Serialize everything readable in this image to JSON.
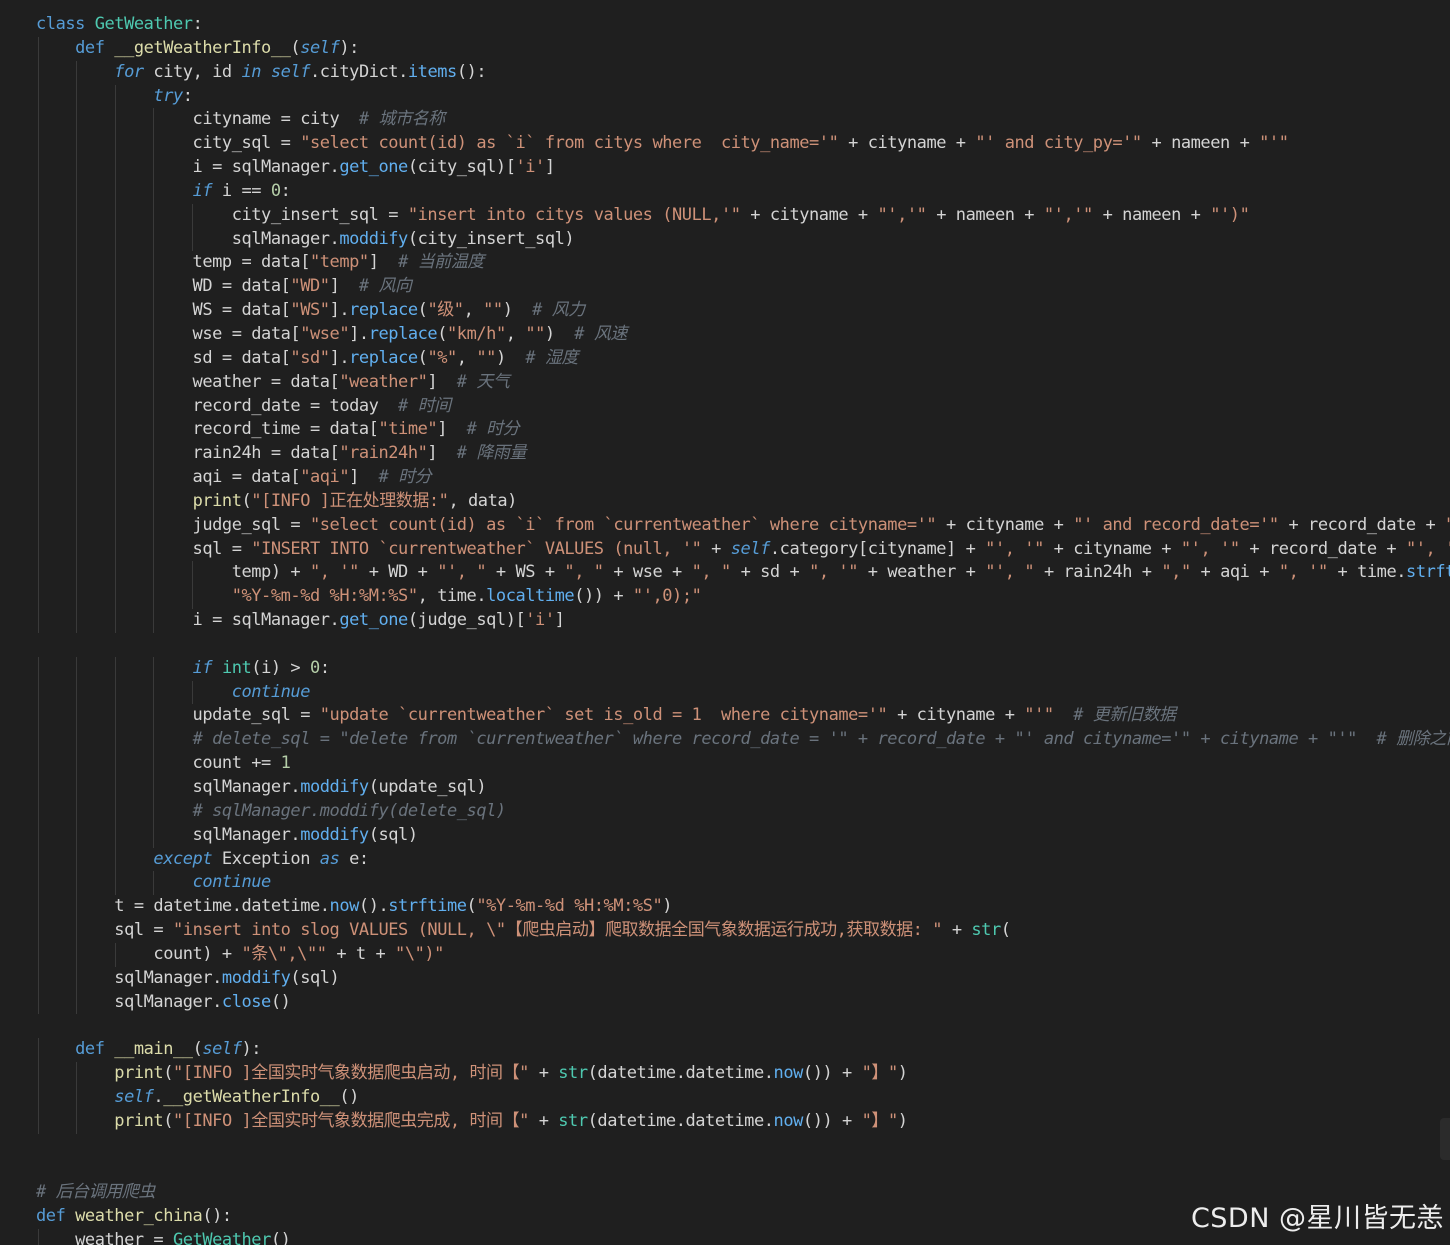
{
  "editor": {
    "watermark": "CSDN @星川皆无恙",
    "lines": [
      [
        [
          "kw",
          "class "
        ],
        [
          "cls",
          "GetWeather"
        ],
        [
          "plain",
          ":"
        ]
      ],
      [
        [
          "plain",
          "    "
        ],
        [
          "kw",
          "def "
        ],
        [
          "fn",
          "__getWeatherInfo__"
        ],
        [
          "plain",
          "("
        ],
        [
          "slf",
          "self"
        ],
        [
          "plain",
          "):"
        ]
      ],
      [
        [
          "plain",
          "        "
        ],
        [
          "kwi",
          "for"
        ],
        [
          "plain",
          " city, id "
        ],
        [
          "kwi",
          "in"
        ],
        [
          "plain",
          " "
        ],
        [
          "slf",
          "self"
        ],
        [
          "plain",
          ".cityDict."
        ],
        [
          "mtd",
          "items"
        ],
        [
          "plain",
          "():"
        ]
      ],
      [
        [
          "plain",
          "            "
        ],
        [
          "kwi",
          "try"
        ],
        [
          "plain",
          ":"
        ]
      ],
      [
        [
          "plain",
          "                cityname = city  "
        ],
        [
          "cmt",
          "# 城市名称"
        ]
      ],
      [
        [
          "plain",
          "                city_sql = "
        ],
        [
          "str",
          "\"select count(id) as `i` from citys where  city_name='\""
        ],
        [
          "plain",
          " + cityname + "
        ],
        [
          "str",
          "\"' and city_py='\""
        ],
        [
          "plain",
          " + nameen + "
        ],
        [
          "str",
          "\"'\""
        ]
      ],
      [
        [
          "plain",
          "                i = sqlManager."
        ],
        [
          "mtd",
          "get_one"
        ],
        [
          "plain",
          "(city_sql)["
        ],
        [
          "str",
          "'i'"
        ],
        [
          "plain",
          "]"
        ]
      ],
      [
        [
          "plain",
          "                "
        ],
        [
          "kwi",
          "if"
        ],
        [
          "plain",
          " i == "
        ],
        [
          "num",
          "0"
        ],
        [
          "plain",
          ":"
        ]
      ],
      [
        [
          "plain",
          "                    city_insert_sql = "
        ],
        [
          "str",
          "\"insert into citys values (NULL,'\""
        ],
        [
          "plain",
          " + cityname + "
        ],
        [
          "str",
          "\"','\""
        ],
        [
          "plain",
          " + nameen + "
        ],
        [
          "str",
          "\"','\""
        ],
        [
          "plain",
          " + nameen + "
        ],
        [
          "str",
          "\"')\""
        ]
      ],
      [
        [
          "plain",
          "                    sqlManager."
        ],
        [
          "mtd",
          "moddify"
        ],
        [
          "plain",
          "(city_insert_sql)"
        ]
      ],
      [
        [
          "plain",
          "                temp = data["
        ],
        [
          "str",
          "\"temp\""
        ],
        [
          "plain",
          "]  "
        ],
        [
          "cmt",
          "# 当前温度"
        ]
      ],
      [
        [
          "plain",
          "                WD = data["
        ],
        [
          "str",
          "\"WD\""
        ],
        [
          "plain",
          "]  "
        ],
        [
          "cmt",
          "# 风向"
        ]
      ],
      [
        [
          "plain",
          "                WS = data["
        ],
        [
          "str",
          "\"WS\""
        ],
        [
          "plain",
          "]."
        ],
        [
          "mtd",
          "replace"
        ],
        [
          "plain",
          "("
        ],
        [
          "str",
          "\"级\""
        ],
        [
          "plain",
          ", "
        ],
        [
          "str",
          "\"\""
        ],
        [
          "plain",
          ")  "
        ],
        [
          "cmt",
          "# 风力"
        ]
      ],
      [
        [
          "plain",
          "                wse = data["
        ],
        [
          "str",
          "\"wse\""
        ],
        [
          "plain",
          "]."
        ],
        [
          "mtd",
          "replace"
        ],
        [
          "plain",
          "("
        ],
        [
          "str",
          "\"km/h\""
        ],
        [
          "plain",
          ", "
        ],
        [
          "str",
          "\"\""
        ],
        [
          "plain",
          ")  "
        ],
        [
          "cmt",
          "# 风速"
        ]
      ],
      [
        [
          "plain",
          "                sd = data["
        ],
        [
          "str",
          "\"sd\""
        ],
        [
          "plain",
          "]."
        ],
        [
          "mtd",
          "replace"
        ],
        [
          "plain",
          "("
        ],
        [
          "str",
          "\"%\""
        ],
        [
          "plain",
          ", "
        ],
        [
          "str",
          "\"\""
        ],
        [
          "plain",
          ")  "
        ],
        [
          "cmt",
          "# 湿度"
        ]
      ],
      [
        [
          "plain",
          "                weather = data["
        ],
        [
          "str",
          "\"weather\""
        ],
        [
          "plain",
          "]  "
        ],
        [
          "cmt",
          "# 天气"
        ]
      ],
      [
        [
          "plain",
          "                record_date = today  "
        ],
        [
          "cmt",
          "# 时间"
        ]
      ],
      [
        [
          "plain",
          "                record_time = data["
        ],
        [
          "str",
          "\"time\""
        ],
        [
          "plain",
          "]  "
        ],
        [
          "cmt",
          "# 时分"
        ]
      ],
      [
        [
          "plain",
          "                rain24h = data["
        ],
        [
          "str",
          "\"rain24h\""
        ],
        [
          "plain",
          "]  "
        ],
        [
          "cmt",
          "# 降雨量"
        ]
      ],
      [
        [
          "plain",
          "                aqi = data["
        ],
        [
          "str",
          "\"aqi\""
        ],
        [
          "plain",
          "]  "
        ],
        [
          "cmt",
          "# 时分"
        ]
      ],
      [
        [
          "plain",
          "                "
        ],
        [
          "fn",
          "print"
        ],
        [
          "plain",
          "("
        ],
        [
          "str",
          "\"[INFO ]正在处理数据:\""
        ],
        [
          "plain",
          ", data)"
        ]
      ],
      [
        [
          "plain",
          "                judge_sql = "
        ],
        [
          "str",
          "\"select count(id) as `i` from `currentweather` where cityname='\""
        ],
        [
          "plain",
          " + cityname + "
        ],
        [
          "str",
          "\"' and record_date='\""
        ],
        [
          "plain",
          " + record_date + "
        ],
        [
          "str",
          "\"'\""
        ]
      ],
      [
        [
          "plain",
          "                sql = "
        ],
        [
          "str",
          "\"INSERT INTO `currentweather` VALUES (null, '\""
        ],
        [
          "plain",
          " + "
        ],
        [
          "slf",
          "self"
        ],
        [
          "plain",
          ".category[cityname] + "
        ],
        [
          "str",
          "\"', '\""
        ],
        [
          "plain",
          " + cityname + "
        ],
        [
          "str",
          "\"', '\""
        ],
        [
          "plain",
          " + record_date + "
        ],
        [
          "str",
          "\"', '\""
        ]
      ],
      [
        [
          "plain",
          "                    temp) + "
        ],
        [
          "str",
          "\", '\""
        ],
        [
          "plain",
          " + WD + "
        ],
        [
          "str",
          "\"', \""
        ],
        [
          "plain",
          " + WS + "
        ],
        [
          "str",
          "\", \""
        ],
        [
          "plain",
          " + wse + "
        ],
        [
          "str",
          "\", \""
        ],
        [
          "plain",
          " + sd + "
        ],
        [
          "str",
          "\", '\""
        ],
        [
          "plain",
          " + weather + "
        ],
        [
          "str",
          "\"', \""
        ],
        [
          "plain",
          " + rain24h + "
        ],
        [
          "str",
          "\",\""
        ],
        [
          "plain",
          " + aqi + "
        ],
        [
          "str",
          "\", '\""
        ],
        [
          "plain",
          " + time."
        ],
        [
          "mtd",
          "strftime"
        ]
      ],
      [
        [
          "plain",
          "                    "
        ],
        [
          "str",
          "\"%Y-%m-%d %H:%M:%S\""
        ],
        [
          "plain",
          ", time."
        ],
        [
          "mtd",
          "localtime"
        ],
        [
          "plain",
          "()) + "
        ],
        [
          "str",
          "\"',0);\""
        ]
      ],
      [
        [
          "plain",
          "                i = sqlManager."
        ],
        [
          "mtd",
          "get_one"
        ],
        [
          "plain",
          "(judge_sql)["
        ],
        [
          "str",
          "'i'"
        ],
        [
          "plain",
          "]"
        ]
      ],
      [],
      [
        [
          "plain",
          "                "
        ],
        [
          "kwi",
          "if"
        ],
        [
          "plain",
          " "
        ],
        [
          "bi",
          "int"
        ],
        [
          "plain",
          "(i) > "
        ],
        [
          "num",
          "0"
        ],
        [
          "plain",
          ":"
        ]
      ],
      [
        [
          "plain",
          "                    "
        ],
        [
          "kwi",
          "continue"
        ]
      ],
      [
        [
          "plain",
          "                update_sql = "
        ],
        [
          "str",
          "\"update `currentweather` set is_old = 1  where cityname='\""
        ],
        [
          "plain",
          " + cityname + "
        ],
        [
          "str",
          "\"'\""
        ],
        [
          "plain",
          "  "
        ],
        [
          "cmt",
          "# 更新旧数据"
        ]
      ],
      [
        [
          "plain",
          "                "
        ],
        [
          "cmt",
          "# delete_sql = \"delete from `currentweather` where record_date = '\" + record_date + \"' and cityname='\" + cityname + \"'\"  # 删除之前"
        ]
      ],
      [
        [
          "plain",
          "                count += "
        ],
        [
          "num",
          "1"
        ]
      ],
      [
        [
          "plain",
          "                sqlManager."
        ],
        [
          "mtd",
          "moddify"
        ],
        [
          "plain",
          "(update_sql)"
        ]
      ],
      [
        [
          "plain",
          "                "
        ],
        [
          "cmt",
          "# sqlManager.moddify(delete_sql)"
        ]
      ],
      [
        [
          "plain",
          "                sqlManager."
        ],
        [
          "mtd",
          "moddify"
        ],
        [
          "plain",
          "(sql)"
        ]
      ],
      [
        [
          "plain",
          "            "
        ],
        [
          "kwi",
          "except"
        ],
        [
          "plain",
          " Exception "
        ],
        [
          "kwi",
          "as"
        ],
        [
          "plain",
          " e:"
        ]
      ],
      [
        [
          "plain",
          "                "
        ],
        [
          "kwi",
          "continue"
        ]
      ],
      [
        [
          "plain",
          "        t = datetime.datetime."
        ],
        [
          "mtd",
          "now"
        ],
        [
          "plain",
          "()."
        ],
        [
          "mtd",
          "strftime"
        ],
        [
          "plain",
          "("
        ],
        [
          "str",
          "\"%Y-%m-%d %H:%M:%S\""
        ],
        [
          "plain",
          ")"
        ]
      ],
      [
        [
          "plain",
          "        sql = "
        ],
        [
          "str",
          "\"insert into slog VALUES (NULL, \\\"【爬虫启动】爬取数据全国气象数据运行成功,获取数据: \""
        ],
        [
          "plain",
          " + "
        ],
        [
          "bi",
          "str"
        ],
        [
          "plain",
          "("
        ]
      ],
      [
        [
          "plain",
          "            count) + "
        ],
        [
          "str",
          "\"条\\\",\\\"\""
        ],
        [
          "plain",
          " + t + "
        ],
        [
          "str",
          "\"\\\")\""
        ]
      ],
      [
        [
          "plain",
          "        sqlManager."
        ],
        [
          "mtd",
          "moddify"
        ],
        [
          "plain",
          "(sql)"
        ]
      ],
      [
        [
          "plain",
          "        sqlManager."
        ],
        [
          "mtd",
          "close"
        ],
        [
          "plain",
          "()"
        ]
      ],
      [],
      [
        [
          "plain",
          "    "
        ],
        [
          "kw",
          "def "
        ],
        [
          "fn",
          "__main__"
        ],
        [
          "plain",
          "("
        ],
        [
          "slf",
          "self"
        ],
        [
          "plain",
          "):"
        ]
      ],
      [
        [
          "plain",
          "        "
        ],
        [
          "fn",
          "print"
        ],
        [
          "plain",
          "("
        ],
        [
          "str",
          "\"[INFO ]全国实时气象数据爬虫启动, 时间【\""
        ],
        [
          "plain",
          " + "
        ],
        [
          "bi",
          "str"
        ],
        [
          "plain",
          "(datetime.datetime."
        ],
        [
          "mtd",
          "now"
        ],
        [
          "plain",
          "()) + "
        ],
        [
          "str",
          "\"】\""
        ],
        [
          "plain",
          ")"
        ]
      ],
      [
        [
          "plain",
          "        "
        ],
        [
          "slf",
          "self"
        ],
        [
          "plain",
          "."
        ],
        [
          "fn",
          "__getWeatherInfo__"
        ],
        [
          "plain",
          "()"
        ]
      ],
      [
        [
          "plain",
          "        "
        ],
        [
          "fn",
          "print"
        ],
        [
          "plain",
          "("
        ],
        [
          "str",
          "\"[INFO ]全国实时气象数据爬虫完成, 时间【\""
        ],
        [
          "plain",
          " + "
        ],
        [
          "bi",
          "str"
        ],
        [
          "plain",
          "(datetime.datetime."
        ],
        [
          "mtd",
          "now"
        ],
        [
          "plain",
          "()) + "
        ],
        [
          "str",
          "\"】\""
        ],
        [
          "plain",
          ")"
        ]
      ],
      [],
      [],
      [
        [
          "cmt",
          "# 后台调用爬虫"
        ]
      ],
      [
        [
          "kw",
          "def "
        ],
        [
          "fn",
          "weather_china"
        ],
        [
          "plain",
          "():"
        ]
      ],
      [
        [
          "plain",
          "    weather = "
        ],
        [
          "cls",
          "GetWeather"
        ],
        [
          "plain",
          "()"
        ]
      ]
    ]
  }
}
